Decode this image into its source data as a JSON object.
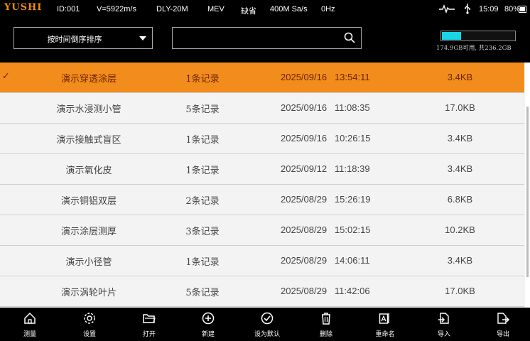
{
  "status": {
    "brand": "YUSHI",
    "id": "ID:001",
    "velocity": "V=5922m/s",
    "probe": "DLY-20M",
    "mode": "MEV",
    "default_label": "缺省",
    "sample_rate": "400M Sa/s",
    "frequency": "0Hz",
    "time": "15:09",
    "battery": "80%",
    "icons": [
      "signal-wave-icon",
      "usb-icon",
      "battery-icon"
    ]
  },
  "toolbar": {
    "sort_label": "按时间倒序排序",
    "search_value": "",
    "storage_text": "174.9GB可用, 共236.2GB",
    "storage_used_fraction": 0.26,
    "accent_color": "#18d6e6"
  },
  "rows": [
    {
      "name": "演示穿透涂层",
      "count": "1条记录",
      "date": "2025/09/16",
      "time": "13:54:11",
      "size": "3.4KB",
      "selected": true,
      "check": "✓"
    },
    {
      "name": "演示水浸测小管",
      "count": "5条记录",
      "date": "2025/09/16",
      "time": "11:08:35",
      "size": "17.0KB"
    },
    {
      "name": "演示接触式盲区",
      "count": "1条记录",
      "date": "2025/09/16",
      "time": "10:26:15",
      "size": "3.4KB"
    },
    {
      "name": "演示氧化皮",
      "count": "1条记录",
      "date": "2025/09/12",
      "time": "11:18:39",
      "size": "3.4KB"
    },
    {
      "name": "演示铜铝双层",
      "count": "2条记录",
      "date": "2025/08/29",
      "time": "15:26:19",
      "size": "6.8KB"
    },
    {
      "name": "演示涂层测厚",
      "count": "3条记录",
      "date": "2025/08/29",
      "time": "15:02:15",
      "size": "10.2KB"
    },
    {
      "name": "演示小径管",
      "count": "1条记录",
      "date": "2025/08/29",
      "time": "14:06:11",
      "size": "3.4KB"
    },
    {
      "name": "演示涡轮叶片",
      "count": "5条记录",
      "date": "2025/08/29",
      "time": "11:42:06",
      "size": "17.0KB"
    }
  ],
  "bottom": [
    {
      "label": "测量",
      "icon": "home-icon"
    },
    {
      "label": "设置",
      "icon": "gear-icon"
    },
    {
      "label": "打开",
      "icon": "folder-open-icon"
    },
    {
      "label": "新建",
      "icon": "plus-circle-icon"
    },
    {
      "label": "设为默认",
      "icon": "check-circle-icon"
    },
    {
      "label": "删除",
      "icon": "trash-icon"
    },
    {
      "label": "重命名",
      "icon": "rename-icon"
    },
    {
      "label": "导入",
      "icon": "import-icon"
    },
    {
      "label": "导出",
      "icon": "export-icon"
    }
  ],
  "colors": {
    "selected_row": "#f28c1c",
    "brand": "#f28c00"
  }
}
